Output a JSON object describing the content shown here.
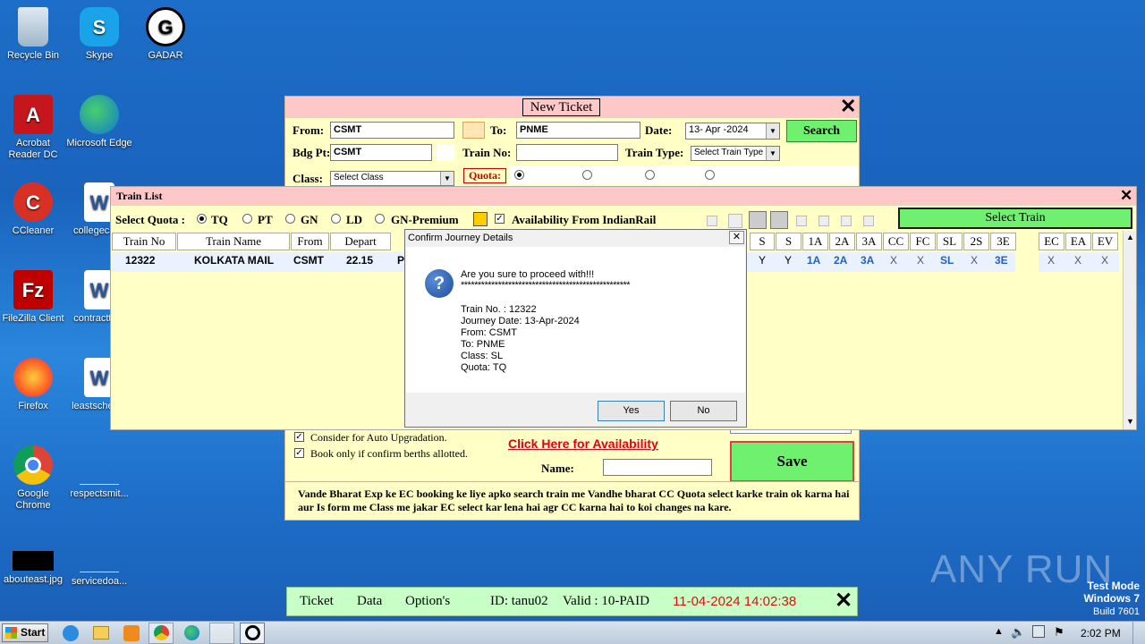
{
  "desktop": {
    "icons": [
      {
        "label": "Recycle Bin"
      },
      {
        "label": "Skype"
      },
      {
        "label": "GADAR"
      },
      {
        "label": "Acrobat Reader DC"
      },
      {
        "label": "Microsoft Edge"
      },
      {
        "label": "CCleaner"
      },
      {
        "label": "collegecal..."
      },
      {
        "label": "FileZilla Client"
      },
      {
        "label": "contracttb..."
      },
      {
        "label": "Firefox"
      },
      {
        "label": "leastsched..."
      },
      {
        "label": "Google Chrome"
      },
      {
        "label": "respectsmit..."
      },
      {
        "label": "abouteast.jpg"
      },
      {
        "label": "servicedoa..."
      }
    ]
  },
  "new_ticket": {
    "title": "New Ticket",
    "from_label": "From:",
    "from_value": "CSMT",
    "to_label": "To:",
    "to_value": "PNME",
    "date_label": "Date:",
    "date_value": "13- Apr -2024",
    "search_button": "Search",
    "bdg_label": "Bdg Pt:",
    "bdg_value": "CSMT",
    "train_no_label": "Train No:",
    "train_no_value": "",
    "train_type_label": "Train Type:",
    "train_type_value": "Select Train Type",
    "class_label": "Class:",
    "class_value": "Select Class",
    "quota_label": "Quota:",
    "auto_upgrade_label": "Consider for Auto Upgradation.",
    "confirm_berths_label": "Book only if confirm berths allotted.",
    "availability_link": "Click Here for Availability",
    "name_label": "Name:",
    "name_value": "",
    "save_button": "Save",
    "note": "Vande Bharat Exp ke EC booking ke liye apko search train me Vandhe bharat CC Quota select karke train ok karna hai aur Is form me Class me jakar EC select kar lena hai agr CC karna hai to koi changes na kare."
  },
  "train_list": {
    "title": "Train List",
    "select_quota_label": "Select Quota :",
    "quotas": [
      "TQ",
      "PT",
      "GN",
      "LD",
      "GN-Premium"
    ],
    "availability_label": "Availability From IndianRail",
    "select_train_button": "Select Train",
    "columns_left": [
      "Train No",
      "Train Name",
      "From",
      "Depart"
    ],
    "columns_right": [
      "S",
      "S",
      "1A",
      "2A",
      "3A",
      "CC",
      "FC",
      "SL",
      "2S",
      "3E",
      "EC",
      "EA",
      "EV"
    ],
    "row": {
      "train_no": "12322",
      "train_name": "KOLKATA MAIL",
      "from": "CSMT",
      "depart": "22.15",
      "partial": "P",
      "right_values": [
        "Y",
        "Y",
        "1A",
        "2A",
        "3A",
        "X",
        "X",
        "SL",
        "X",
        "3E",
        "X",
        "X",
        "X"
      ]
    }
  },
  "dialog": {
    "title": "Confirm Journey Details",
    "question": "Are you sure to proceed with!!!",
    "stars": "**************************************************",
    "lines": [
      "Train No. : 12322",
      "Journey Date: 13-Apr-2024",
      "From: CSMT",
      "To: PNME",
      "Class: SL",
      "Quota: TQ"
    ],
    "yes_button": "Yes",
    "no_button": "No"
  },
  "bottom_bar": {
    "menu": [
      "Ticket",
      "Data",
      "Option's"
    ],
    "id_text": "ID: tanu02",
    "valid_text": "Valid : 10-PAID",
    "datetime": "11-04-2024 14:02:38"
  },
  "watermark": {
    "brand": "ANY RUN",
    "line1": "Test Mode",
    "line2": "Windows 7",
    "line3": "Build 7601"
  },
  "taskbar": {
    "start_label": "Start",
    "clock": "2:02 PM"
  }
}
